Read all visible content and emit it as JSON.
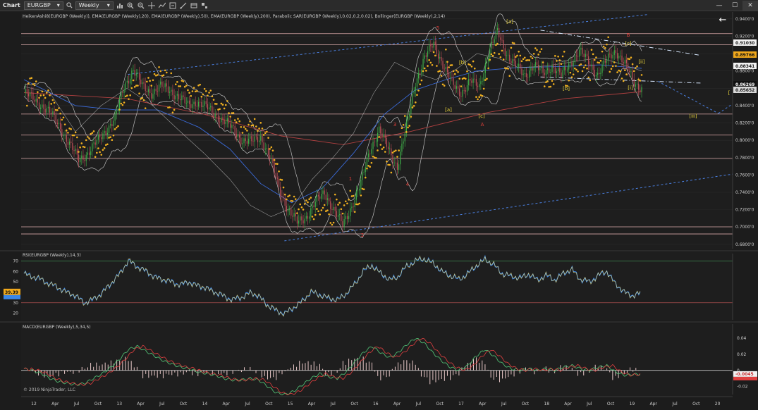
{
  "toolbar": {
    "chart_label": "Chart",
    "instrument": "EURGBP",
    "period": "Weekly"
  },
  "panels": {
    "price": {
      "legend": "HeikenAshi8(EURGBP (Weekly)), EMA(EURGBP (Weekly),20), EMA(EURGBP (Weekly),50), EMA(EURGBP (Weekly),200), Parabolic SAR(EURGBP (Weekly),0.02,0.2,0.02), Bollinger(EURGBP (Weekly),2,14)",
      "y_ticks": [
        "0.9400'0",
        "0.9200'0",
        "0.9000'0",
        "0.8800'0",
        "0.8600'0",
        "0.8400'0",
        "0.8200'0",
        "0.8000'0",
        "0.7800'0",
        "0.7600'0",
        "0.7400'0",
        "0.7200'0",
        "0.7000'0",
        "0.6800'0"
      ],
      "price_labels": [
        {
          "text": "0.91030",
          "color": "#1a1a1a",
          "bg": "#f2f2f2"
        },
        {
          "text": "0.89766",
          "color": "#111111",
          "bg": "#f0a81c"
        },
        {
          "text": "0.88341",
          "color": "#1a1a1a",
          "bg": "#f2f2f2"
        },
        {
          "text": "0.86269",
          "color": "#ffffff",
          "bg": "#111111"
        },
        {
          "text": "0.85652",
          "color": "#1a1a1a",
          "bg": "#d9d9d9"
        }
      ],
      "wave_labels": [
        {
          "text": "5",
          "color": "#e2403a"
        },
        {
          "text": "[a]",
          "color": "#e8d23a"
        },
        {
          "text": "B",
          "color": "#e2403a"
        },
        {
          "text": "[c]",
          "color": "#e8d23a"
        },
        {
          "text": "[b]",
          "color": "#e8d23a"
        },
        {
          "text": "[ii]",
          "color": "#e8d23a"
        },
        {
          "text": "[b]",
          "color": "#e8d23a"
        },
        {
          "text": "[i]",
          "color": "#e8d23a"
        },
        {
          "text": "[a]",
          "color": "#e8d23a"
        },
        {
          "text": "[c]",
          "color": "#e8d23a"
        },
        {
          "text": "A",
          "color": "#e2403a"
        },
        {
          "text": "3",
          "color": "#e2403a"
        },
        {
          "text": "4",
          "color": "#e2403a"
        },
        {
          "text": "1",
          "color": "#e2403a"
        },
        {
          "text": "2",
          "color": "#e2403a"
        },
        {
          "text": "[iii]",
          "color": "#e8d23a"
        },
        {
          "text": "[",
          "color": "#e8d23a"
        }
      ]
    },
    "rsi": {
      "legend": "RSI(EURGBP (Weekly),14,3)",
      "y_ticks": [
        "70",
        "60",
        "50",
        "40",
        "30",
        "20"
      ],
      "last_value": "39.39"
    },
    "macd": {
      "legend": "MACD(EURGBP (Weekly),5,34,5)",
      "y_ticks": [
        "0.04",
        "0.02",
        "0",
        "-0.02"
      ],
      "last_value": "-0.0045"
    }
  },
  "x_axis": {
    "labels": [
      "12",
      "Apr",
      "Jul",
      "Oct",
      "13",
      "Apr",
      "Jul",
      "Oct",
      "14",
      "Apr",
      "Jul",
      "Oct",
      "15",
      "Apr",
      "Jul",
      "Oct",
      "16",
      "Apr",
      "Jul",
      "Oct",
      "17",
      "Apr",
      "Jul",
      "Oct",
      "18",
      "Apr",
      "Jul",
      "Oct",
      "19",
      "Apr",
      "Jul",
      "Oct",
      "20"
    ]
  },
  "copyright": "© 2019 NinjaTrader, LLC",
  "colors": {
    "background": "#1c1c1c",
    "bull_candle": "#3fae49",
    "bear_candle": "#c0505a",
    "sar": "#f0b020",
    "ema20": "#e8e8e8",
    "ema50": "#3a6ad8",
    "ema200": "#b04040",
    "bollinger": "#bbbbbb",
    "trendline": "#4a7fe0",
    "hline": "#d9a8a8",
    "rsi_line": "#3a86e8",
    "rsi_signal": "#e8e08a",
    "macd_line": "#4fb870",
    "macd_signal": "#e04040",
    "macd_hist": "#e8c8c8"
  },
  "chart_data": [
    {
      "type": "candlestick",
      "title": "EURGBP (Weekly)",
      "ylim": [
        0.675,
        0.948
      ],
      "waypoints": [
        [
          0.86,
          0.855
        ],
        [
          0.865,
          0.848
        ],
        [
          0.85,
          0.84
        ],
        [
          0.835,
          0.83
        ],
        [
          0.825,
          0.815
        ],
        [
          0.806,
          0.795
        ],
        [
          0.79,
          0.778
        ],
        [
          0.782,
          0.785
        ],
        [
          0.79,
          0.798
        ],
        [
          0.805,
          0.812
        ],
        [
          0.815,
          0.825
        ],
        [
          0.845,
          0.862
        ],
        [
          0.872,
          0.882
        ],
        [
          0.872,
          0.862
        ],
        [
          0.86,
          0.855
        ],
        [
          0.858,
          0.862
        ],
        [
          0.864,
          0.858
        ],
        [
          0.855,
          0.85
        ],
        [
          0.846,
          0.84
        ],
        [
          0.838,
          0.845
        ],
        [
          0.842,
          0.838
        ],
        [
          0.835,
          0.83
        ],
        [
          0.826,
          0.822
        ],
        [
          0.818,
          0.812
        ],
        [
          0.808,
          0.8
        ],
        [
          0.796,
          0.798
        ],
        [
          0.8,
          0.804
        ],
        [
          0.792,
          0.78
        ],
        [
          0.765,
          0.745
        ],
        [
          0.735,
          0.72
        ],
        [
          0.715,
          0.705
        ],
        [
          0.708,
          0.712
        ],
        [
          0.718,
          0.728
        ],
        [
          0.73,
          0.74
        ],
        [
          0.733,
          0.72
        ],
        [
          0.716,
          0.702
        ],
        [
          0.71,
          0.725
        ],
        [
          0.735,
          0.75
        ],
        [
          0.76,
          0.79
        ],
        [
          0.8,
          0.812
        ],
        [
          0.808,
          0.79
        ],
        [
          0.778,
          0.77
        ],
        [
          0.79,
          0.815
        ],
        [
          0.84,
          0.868
        ],
        [
          0.872,
          0.895
        ],
        [
          0.905,
          0.912
        ],
        [
          0.9,
          0.888
        ],
        [
          0.878,
          0.865
        ],
        [
          0.862,
          0.855
        ],
        [
          0.86,
          0.868
        ],
        [
          0.866,
          0.862
        ],
        [
          0.88,
          0.9
        ],
        [
          0.915,
          0.925
        ],
        [
          0.91,
          0.9
        ],
        [
          0.892,
          0.885
        ],
        [
          0.882,
          0.875
        ],
        [
          0.88,
          0.887
        ],
        [
          0.885,
          0.877
        ],
        [
          0.878,
          0.886
        ],
        [
          0.882,
          0.874
        ],
        [
          0.88,
          0.89
        ],
        [
          0.898,
          0.903
        ],
        [
          0.9,
          0.89
        ],
        [
          0.88,
          0.876
        ],
        [
          0.88,
          0.892
        ],
        [
          0.9,
          0.904
        ],
        [
          0.9,
          0.888
        ],
        [
          0.88,
          0.866
        ],
        [
          0.864,
          0.86
        ]
      ],
      "ema20": [
        [
          0,
          0.862
        ],
        [
          5,
          0.855
        ],
        [
          10,
          0.81
        ],
        [
          15,
          0.84
        ],
        [
          20,
          0.86
        ],
        [
          25,
          0.84
        ],
        [
          30,
          0.812
        ],
        [
          35,
          0.785
        ],
        [
          40,
          0.755
        ],
        [
          44,
          0.725
        ],
        [
          48,
          0.712
        ],
        [
          52,
          0.722
        ],
        [
          56,
          0.755
        ],
        [
          60,
          0.78
        ],
        [
          64,
          0.808
        ],
        [
          68,
          0.855
        ],
        [
          72,
          0.89
        ],
        [
          76,
          0.878
        ],
        [
          80,
          0.87
        ],
        [
          84,
          0.882
        ],
        [
          88,
          0.9
        ],
        [
          92,
          0.895
        ],
        [
          96,
          0.884
        ],
        [
          100,
          0.885
        ],
        [
          104,
          0.888
        ],
        [
          108,
          0.892
        ],
        [
          112,
          0.895
        ],
        [
          116,
          0.888
        ],
        [
          120,
          0.88
        ]
      ],
      "ema50": [
        [
          0,
          0.87
        ],
        [
          10,
          0.84
        ],
        [
          18,
          0.835
        ],
        [
          26,
          0.835
        ],
        [
          34,
          0.815
        ],
        [
          40,
          0.79
        ],
        [
          46,
          0.75
        ],
        [
          52,
          0.728
        ],
        [
          58,
          0.745
        ],
        [
          64,
          0.785
        ],
        [
          70,
          0.83
        ],
        [
          76,
          0.858
        ],
        [
          82,
          0.87
        ],
        [
          88,
          0.88
        ],
        [
          96,
          0.884
        ],
        [
          104,
          0.885
        ],
        [
          112,
          0.887
        ],
        [
          120,
          0.883
        ]
      ],
      "ema200": [
        [
          0,
          0.855
        ],
        [
          20,
          0.848
        ],
        [
          35,
          0.83
        ],
        [
          50,
          0.805
        ],
        [
          62,
          0.795
        ],
        [
          75,
          0.81
        ],
        [
          90,
          0.832
        ],
        [
          105,
          0.848
        ],
        [
          120,
          0.856
        ]
      ],
      "hlines": [
        0.923,
        0.9103,
        0.8303,
        0.806,
        0.779,
        0.7002,
        0.692
      ],
      "trendlines": [
        {
          "from": [
            0.15,
            0.876
          ],
          "to": [
            0.88,
            0.945
          ],
          "dash": "3,3"
        },
        {
          "from": [
            0.37,
            0.684
          ],
          "to": [
            1.0,
            0.761
          ],
          "dash": "3,3"
        },
        {
          "from": [
            0.73,
            0.927
          ],
          "to": [
            0.955,
            0.898
          ],
          "dash": "6,3,1,3"
        },
        {
          "from": [
            0.73,
            0.873
          ],
          "to": [
            0.955,
            0.866
          ],
          "dash": "6,3,1,3"
        },
        {
          "from": [
            0.895,
            0.868
          ],
          "to": [
            0.98,
            0.831
          ],
          "dash": "3,3"
        },
        {
          "from": [
            0.98,
            0.831
          ],
          "to": [
            1.0,
            0.842
          ],
          "dash": "3,3"
        }
      ]
    },
    {
      "type": "line",
      "title": "RSI(EURGBP (Weekly),14,3)",
      "ylim": [
        15,
        75
      ],
      "hlines": [
        70,
        30
      ],
      "series": [
        {
          "values": [
            58,
            55,
            52,
            48,
            44,
            40,
            36,
            30,
            33,
            40,
            48,
            58,
            70,
            65,
            60,
            55,
            52,
            50,
            47,
            50,
            46,
            44,
            40,
            36,
            33,
            35,
            40,
            36,
            28,
            22,
            20,
            25,
            32,
            40,
            38,
            34,
            33,
            38,
            48,
            60,
            66,
            58,
            52,
            55,
            65,
            70,
            72,
            68,
            60,
            56,
            52,
            58,
            65,
            72,
            66,
            58,
            55,
            54,
            57,
            52,
            56,
            52,
            58,
            62,
            52,
            50,
            56,
            60,
            48,
            40,
            37,
            39
          ]
        }
      ]
    },
    {
      "type": "line",
      "title": "MACD(EURGBP (Weekly),5,34,5)",
      "ylim": [
        -0.03,
        0.055
      ],
      "hlines": [
        0
      ],
      "series": [
        {
          "values": [
            0.002,
            0.0,
            -0.004,
            -0.01,
            -0.014,
            -0.016,
            -0.018,
            -0.016,
            -0.01,
            -0.004,
            0.004,
            0.014,
            0.026,
            0.03,
            0.024,
            0.018,
            0.012,
            0.008,
            0.004,
            0.002,
            -0.002,
            -0.004,
            -0.006,
            -0.01,
            -0.012,
            -0.012,
            -0.01,
            -0.012,
            -0.02,
            -0.028,
            -0.03,
            -0.026,
            -0.018,
            -0.01,
            -0.004,
            -0.008,
            -0.01,
            -0.002,
            0.01,
            0.022,
            0.03,
            0.022,
            0.016,
            0.022,
            0.032,
            0.04,
            0.034,
            0.022,
            0.012,
            0.004,
            0.0,
            0.006,
            0.018,
            0.026,
            0.018,
            0.008,
            0.002,
            0.0,
            0.002,
            0.0,
            0.002,
            0.0,
            0.004,
            0.006,
            0.002,
            0.0,
            0.004,
            0.006,
            -0.002,
            -0.006,
            -0.005,
            -0.0045
          ]
        }
      ]
    }
  ]
}
